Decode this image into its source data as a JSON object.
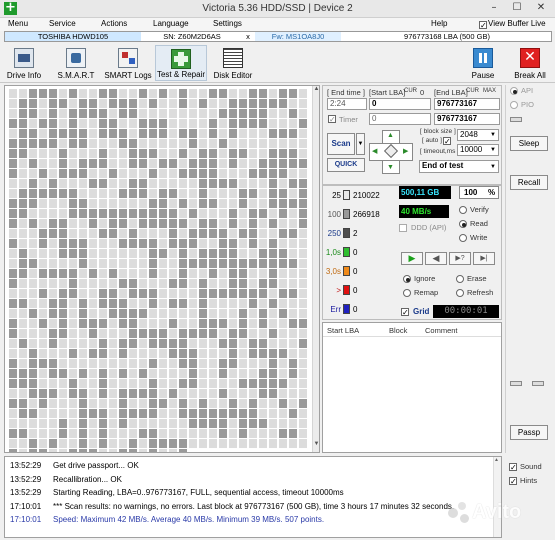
{
  "window": {
    "title": "Victoria 5.36 HDD/SSD | Device 2",
    "icon": "plus-icon",
    "controls": [
      "–",
      "☐",
      "✕"
    ]
  },
  "menu": [
    "Menu",
    "Service",
    "Actions",
    "Language",
    "Settings",
    "Help"
  ],
  "buffer_live": {
    "label": "View Buffer Live",
    "checked": true
  },
  "drive": {
    "model": "TOSHIBA HDWD105",
    "serial": "SN: Z60M2D6AS",
    "close": "x",
    "firmware": "Fw: MS1OA8J0",
    "capacity": "976773168 LBA (500 GB)"
  },
  "toolbar": {
    "drive_info": {
      "label": "Drive Info",
      "icon": "drive-info-icon"
    },
    "smart": {
      "label": "S.M.A.R.T",
      "icon": "smart-icon"
    },
    "smart_logs": {
      "label": "SMART Logs",
      "icon": "smart-logs-icon"
    },
    "test_repair": {
      "label": "Test & Repair",
      "icon": "test-repair-icon"
    },
    "disk_editor": {
      "label": "Disk Editor",
      "icon": "disk-editor-icon"
    },
    "pause": {
      "label": "Pause",
      "icon": "pause-icon"
    },
    "break_all": {
      "label": "Break All",
      "icon": "break-all-icon"
    }
  },
  "scan": {
    "end_time_label": "[ End time ]",
    "end_time": "2:24",
    "timer_label": "Timer",
    "timer_value": "0",
    "start_lba_label": "[Start LBA]",
    "start_lba": "0",
    "cur_label": "CUR",
    "cur_value": "0",
    "end_lba_label": "[End LBA]",
    "end_lba_cur": "CUR",
    "end_lba_max": "MAX",
    "end_lba": "976773167",
    "end_lba_2": "976773167",
    "block_size_label": "[ block size ]",
    "auto_label": "[ auto ]",
    "block_size": "2048",
    "timeout_label": "[ timeout,ms ]",
    "timeout": "10000",
    "scan_button": "Scan",
    "quick_button": "QUICK",
    "end_action": "End of test"
  },
  "legend": [
    {
      "label": "25",
      "count": "210022",
      "color": "#e8e8e8"
    },
    {
      "label": "100",
      "count": "266918",
      "color": "#9a9a9a"
    },
    {
      "label": "250",
      "count": "2",
      "color": "#4f4f4f"
    },
    {
      "label": "1,0s",
      "count": "0",
      "color": "#2fbf2f"
    },
    {
      "label": "3,0s",
      "count": "0",
      "color": "#f08a1a"
    },
    {
      "label": ">",
      "count": "0",
      "color": "#e01010"
    },
    {
      "label": "Err",
      "count": "0",
      "color": "#2020c0"
    }
  ],
  "stats": {
    "done": "500,11 GB",
    "percent": "100",
    "percent_unit": "%",
    "speed": "40 MB/s"
  },
  "mode": {
    "verify": "Verify",
    "read": "Read",
    "write": "Write",
    "selected": "read"
  },
  "ddd_api": "DDD (API)",
  "repair": {
    "ignore": "Ignore",
    "erase": "Erase",
    "remap": "Remap",
    "refresh": "Refresh",
    "selected": "ignore"
  },
  "grid_toggle": {
    "label": "Grid",
    "checked": true,
    "time": "00:00:01"
  },
  "results_table": {
    "columns": [
      "Start LBA",
      "Block",
      "Comment"
    ]
  },
  "side": {
    "api": "API",
    "pio": "PIO",
    "sleep": "Sleep",
    "recall": "Recall",
    "passp": "Passp"
  },
  "log": [
    {
      "time": "13:52:29",
      "msg": "Get drive passport... OK",
      "color": "#000000"
    },
    {
      "time": "13:52:29",
      "msg": "Recallibration... OK",
      "color": "#000000"
    },
    {
      "time": "13:52:29",
      "msg": "Starting Reading, LBA=0..976773167, FULL, sequential access, timeout 10000ms",
      "color": "#000000"
    },
    {
      "time": "17:10:01",
      "msg": "*** Scan results: no warnings, no errors. Last block at 976773167 (500 GB), time 3 hours 17 minutes 32 seconds.",
      "color": "#000000"
    },
    {
      "time": "17:10:01",
      "msg": "Speed: Maximum 42 MB/s. Average 40 MB/s. Minimum 39 MB/s. 507 points.",
      "color": "#2a3aa8"
    }
  ],
  "options": {
    "sound": "Sound",
    "hints": "Hints"
  },
  "watermark": "Avito"
}
